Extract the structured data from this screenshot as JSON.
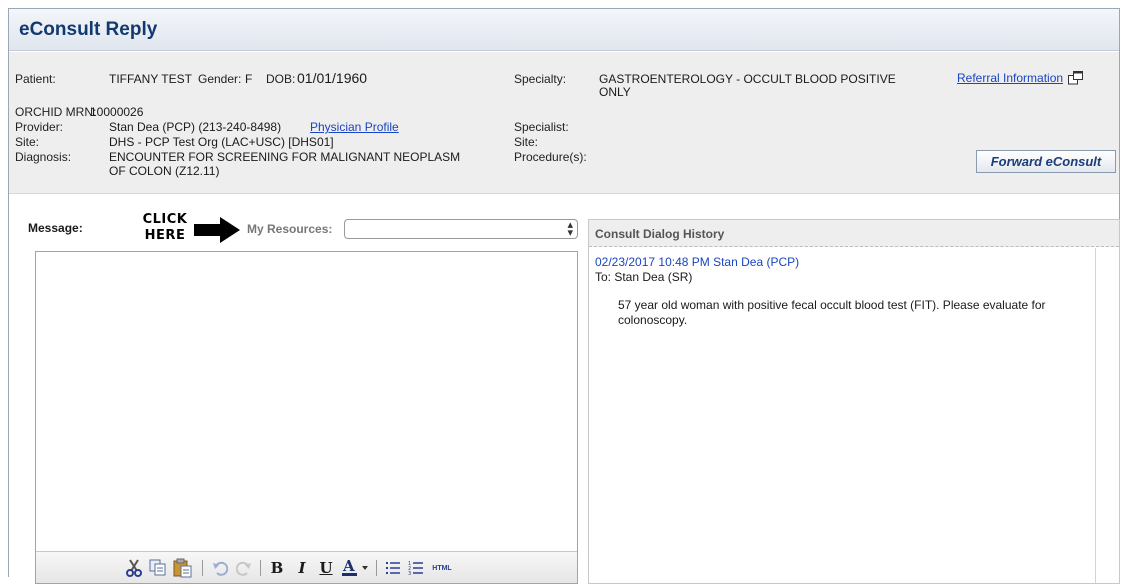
{
  "window": {
    "title": "eConsult Reply"
  },
  "patient_info": {
    "patient_label": "Patient:",
    "patient_name": "TIFFANY TEST",
    "gender_label": "Gender:",
    "gender_value": "F",
    "dob_label": "DOB:",
    "dob_value": "01/01/1960",
    "mrn_label": "ORCHID MRN:",
    "mrn_value": "10000026",
    "provider_label": "Provider:",
    "provider_value": "Stan Dea (PCP) (213-240-8498)",
    "physician_profile_link": "Physician Profile",
    "site_label": "Site:",
    "site_value": "DHS - PCP Test Org (LAC+USC) [DHS01]",
    "diagnosis_label": "Diagnosis:",
    "diagnosis_line1": "ENCOUNTER FOR SCREENING FOR MALIGNANT NEOPLASM",
    "diagnosis_line2": "OF COLON (Z12.11)"
  },
  "consult_info": {
    "specialty_label": "Specialty:",
    "specialty_line1": "GASTROENTEROLOGY - OCCULT BLOOD POSITIVE",
    "specialty_line2": "ONLY",
    "specialist_label": "Specialist:",
    "site_label": "Site:",
    "procedures_label": "Procedure(s):",
    "referral_link": "Referral Information",
    "forward_button": "Forward eConsult"
  },
  "message_area": {
    "message_label": "Message:",
    "callout_line1": "CLICK",
    "callout_line2": "HERE",
    "resources_label": "My Resources:",
    "resources_selected": "",
    "editor_value": ""
  },
  "toolbar": {
    "icons": [
      "cut-icon",
      "copy-icon",
      "paste-icon",
      "undo-icon",
      "redo-icon",
      "bold-icon",
      "italic-icon",
      "underline-icon",
      "font-color-icon",
      "bullet-list-icon",
      "numbered-list-icon",
      "html-icon"
    ],
    "html_label": "HTML"
  },
  "history": {
    "title": "Consult Dialog History",
    "entries": [
      {
        "date": "02/23/2017 10:48 PM Stan Dea (PCP)",
        "to": "To: Stan Dea (SR)",
        "message": "57 year old woman with positive fecal occult blood test (FIT). Please evaluate for colonoscopy."
      }
    ]
  }
}
